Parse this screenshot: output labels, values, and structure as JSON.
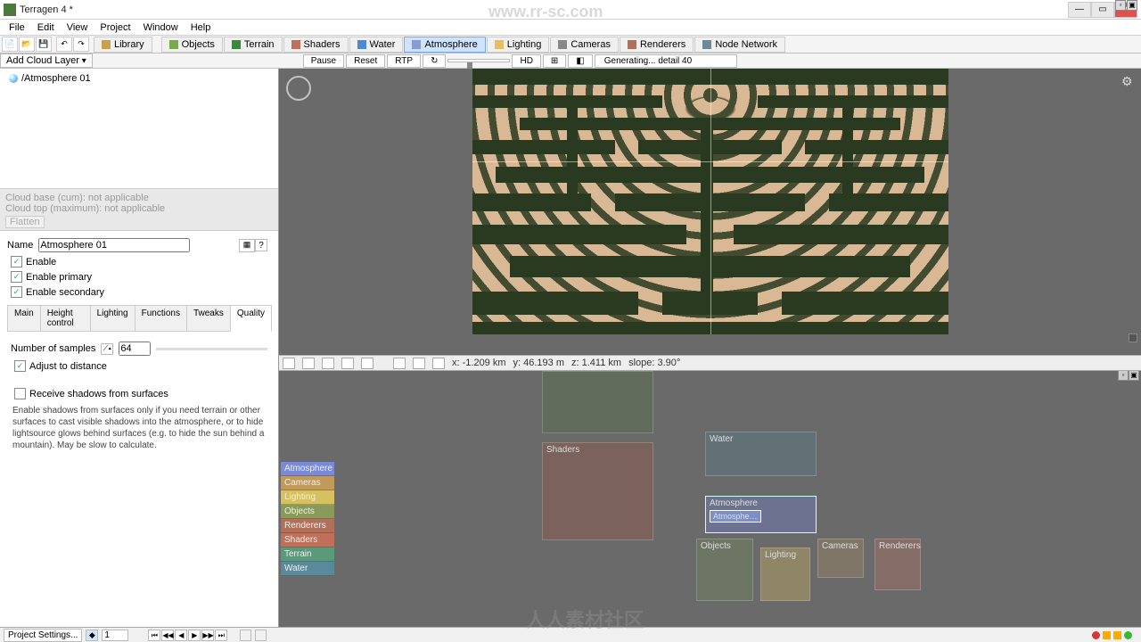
{
  "window": {
    "title": "Terragen 4 *"
  },
  "menu": [
    "File",
    "Edit",
    "View",
    "Project",
    "Window",
    "Help"
  ],
  "toolbar": {
    "library": "Library",
    "tabs": {
      "objects": "Objects",
      "terrain": "Terrain",
      "shaders": "Shaders",
      "water": "Water",
      "atmosphere": "Atmosphere",
      "lighting": "Lighting",
      "cameras": "Cameras",
      "renderers": "Renderers",
      "node_network": "Node Network"
    }
  },
  "second": {
    "add_cloud": "Add Cloud Layer",
    "pause": "Pause",
    "reset": "Reset",
    "rtp": "RTP",
    "auto": "↻",
    "hd": "HD",
    "generating": "Generating... detail 40"
  },
  "tree": {
    "item1": "/Atmosphere 01"
  },
  "infobar": {
    "l1": "Cloud base (cum): not applicable",
    "l2": "Cloud top (maximum): not applicable",
    "l3": "Flatten"
  },
  "props": {
    "name_label": "Name",
    "name_value": "Atmosphere 01",
    "enable": "Enable",
    "enable_primary": "Enable primary",
    "enable_secondary": "Enable secondary",
    "tabs": {
      "main": "Main",
      "height": "Height control",
      "lighting": "Lighting",
      "functions": "Functions",
      "tweaks": "Tweaks",
      "quality": "Quality"
    },
    "num_samples_label": "Number of samples",
    "num_samples_value": "64",
    "adjust": "Adjust to distance",
    "receive": "Receive shadows from surfaces",
    "helptext": "Enable shadows from surfaces only if you need terrain or other surfaces to cast visible shadows into the atmosphere, or to hide lightsource glows behind surfaces (e.g. to hide the sun behind a mountain). May be slow to calculate.",
    "help_q": "?"
  },
  "vstatus": {
    "x": "x: -1.209 km",
    "y": "y: 46.193 m",
    "z": "z: 1.411 km",
    "slope": "slope: 3.90°"
  },
  "nodelist": {
    "atmosphere": "Atmosphere",
    "cameras": "Cameras",
    "lighting": "Lighting",
    "objects": "Objects",
    "renderers": "Renderers",
    "shaders": "Shaders",
    "terrain": "Terrain",
    "water": "Water"
  },
  "nodegroups": {
    "shaders": "Shaders",
    "water": "Water",
    "atmosphere": "Atmosphere",
    "objects": "Objects",
    "lighting": "Lighting",
    "cameras": "Cameras",
    "renderers": "Renderers"
  },
  "statusbar": {
    "project_settings": "Project Settings...",
    "frame": "1"
  },
  "watermark": {
    "url": "www.rr-sc.com",
    "text": "人人素材社区"
  }
}
